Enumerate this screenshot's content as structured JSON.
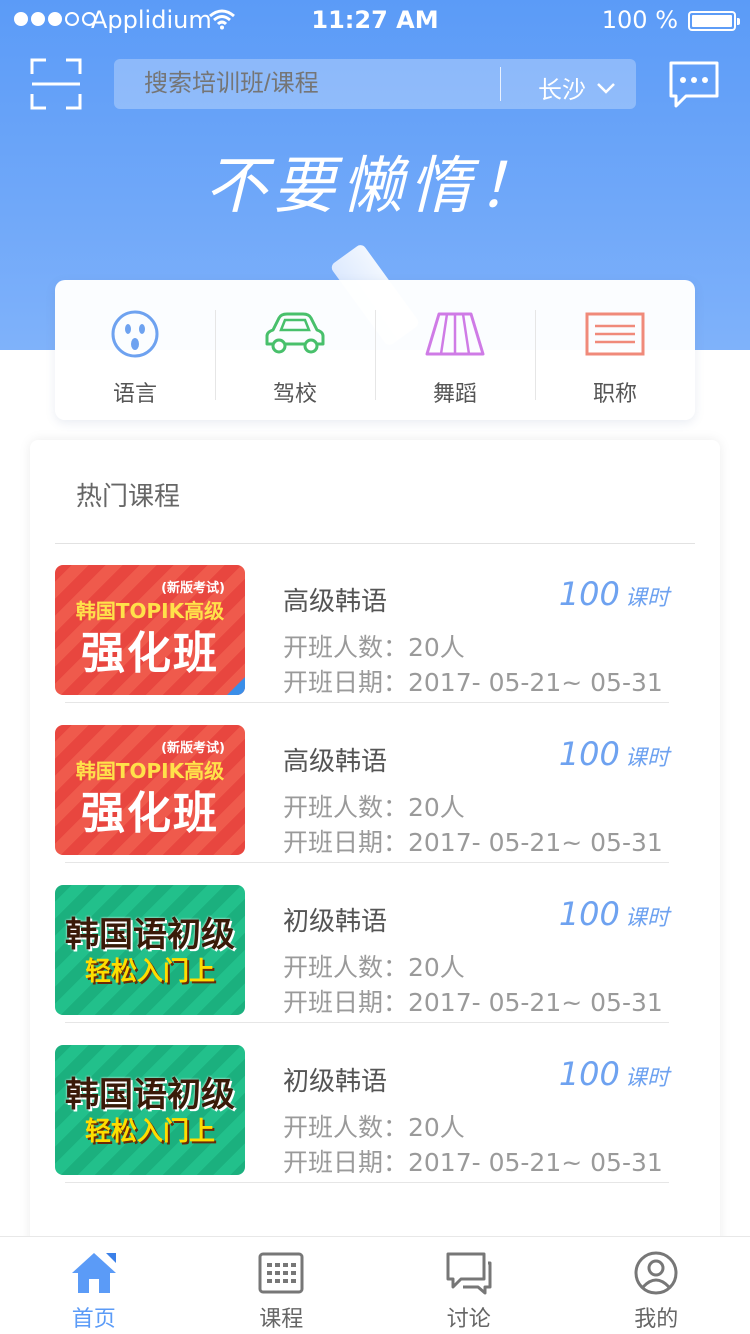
{
  "status_bar": {
    "carrier": "Applidium",
    "time": "11:27 AM",
    "battery": "100 %"
  },
  "header": {
    "search_placeholder": "搜索培训班/课程",
    "city": "长沙",
    "slogan": "不要懒惰！"
  },
  "categories": [
    {
      "label": "语言",
      "icon": "language-icon",
      "color": "#6ea2f0"
    },
    {
      "label": "驾校",
      "icon": "car-icon",
      "color": "#48c06b"
    },
    {
      "label": "舞蹈",
      "icon": "dance-skirt-icon",
      "color": "#cf7be6"
    },
    {
      "label": "职称",
      "icon": "certificate-icon",
      "color": "#f08a7a"
    }
  ],
  "hot_courses": {
    "title": "热门课程",
    "items": [
      {
        "name": "高级韩语",
        "hours_num": "100",
        "hours_unit": "课时",
        "count": "开班人数：20人",
        "date": "开班日期：2017- 05-21~ 05-31",
        "thumb": {
          "style": "red",
          "tag": "(新版考试)",
          "line1": "韩国TOPIK高级",
          "line2": "强化班"
        }
      },
      {
        "name": "高级韩语",
        "hours_num": "100",
        "hours_unit": "课时",
        "count": "开班人数：20人",
        "date": "开班日期：2017- 05-21~ 05-31",
        "thumb": {
          "style": "red",
          "tag": "(新版考试)",
          "line1": "韩国TOPIK高级",
          "line2": "强化班"
        }
      },
      {
        "name": "初级韩语",
        "hours_num": "100",
        "hours_unit": "课时",
        "count": "开班人数：20人",
        "date": "开班日期：2017- 05-21~ 05-31",
        "thumb": {
          "style": "green",
          "tag": "",
          "line1": "韩国语初级",
          "line2": "轻松入门上"
        }
      },
      {
        "name": "初级韩语",
        "hours_num": "100",
        "hours_unit": "课时",
        "count": "开班人数：20人",
        "date": "开班日期：2017- 05-21~ 05-31",
        "thumb": {
          "style": "green",
          "tag": "",
          "line1": "韩国语初级",
          "line2": "轻松入门上"
        }
      }
    ]
  },
  "tabbar": [
    {
      "label": "首页",
      "icon": "home-icon",
      "active": true
    },
    {
      "label": "课程",
      "icon": "course-list-icon",
      "active": false
    },
    {
      "label": "讨论",
      "icon": "chat-bubbles-icon",
      "active": false
    },
    {
      "label": "我的",
      "icon": "profile-icon",
      "active": false
    }
  ],
  "colors": {
    "primary": "#5b9bf7",
    "accent_hours": "#6ea2f0",
    "text_secondary": "#9a9a9a"
  }
}
